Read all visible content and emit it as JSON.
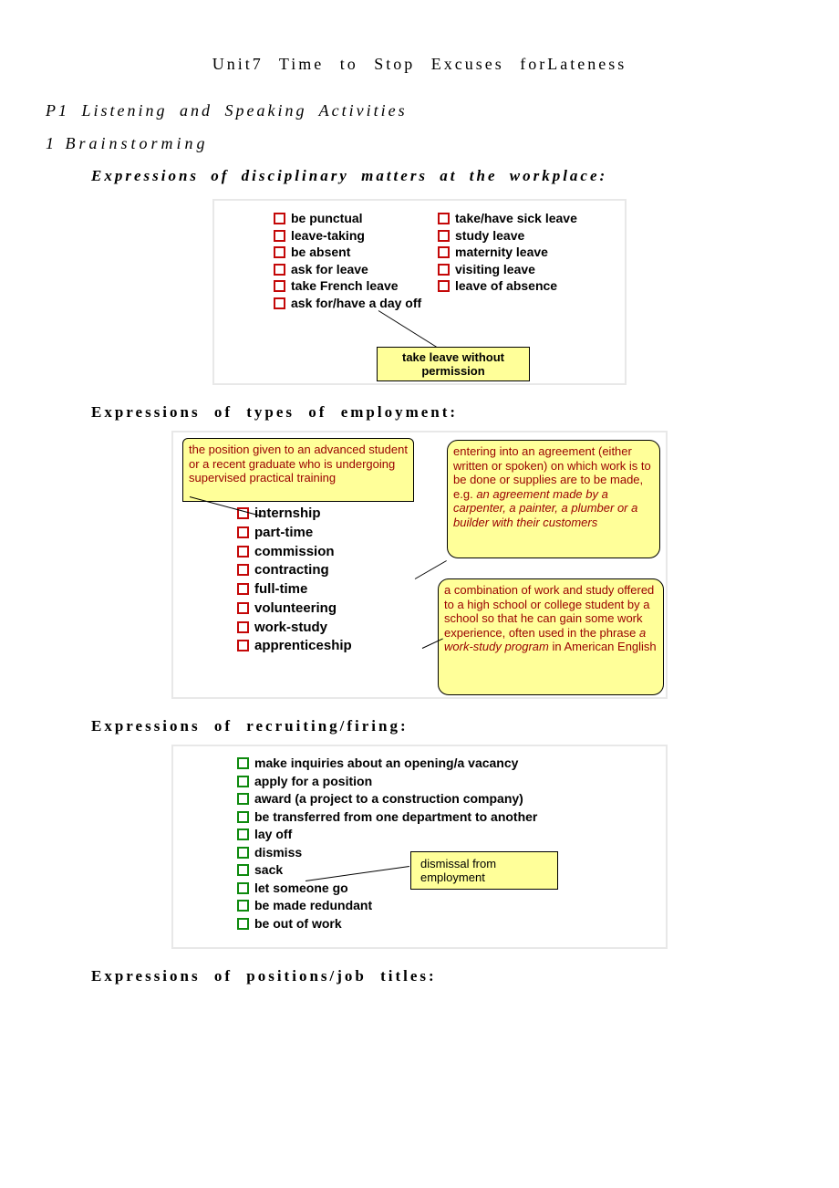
{
  "title": "Unit7  Time  to Stop  Excuses forLateness",
  "p1": "P1 Listening and Speaking Activities",
  "brainstorm": "1 Brainstorming",
  "sub1_label": "Expressions of disciplinary matters at the workplace:",
  "fig1": {
    "left": [
      "be punctual",
      "leave-taking",
      "be absent",
      "ask for leave",
      "take French leave",
      "ask for/have a day off"
    ],
    "right": [
      "take/have sick leave",
      "study leave",
      "maternity leave",
      "visiting leave",
      "leave of absence"
    ],
    "callout": "take leave without permission"
  },
  "sub2_label": "Expressions of types of employment:",
  "fig2": {
    "note1": "the position given to an advanced student or a recent graduate who is undergoing supervised practical training",
    "note2_a": "entering into an agreement (either written or spoken) on which work is to be done or supplies are to be made, e.g.",
    "note2_b": "an agreement made by a carpenter, a painter, a plumber or a builder with their customers",
    "note3_a": "a combination of work and study offered to a high school or college student by a school so that he can gain some work experience, often used in the phrase ",
    "note3_b": "a work-study program",
    "note3_c": " in American English",
    "items": [
      "internship",
      "part-time",
      "commission",
      "contracting",
      "full-time",
      "volunteering",
      "work-study",
      "apprenticeship"
    ]
  },
  "sub3_label": "Expressions of recruiting/firing:",
  "fig3": {
    "items": [
      "make inquiries about an opening/a vacancy",
      "apply for a position",
      "award (a project to a construction company)",
      "be transferred from one department to another",
      "lay off",
      "dismiss",
      "sack",
      "let someone go",
      "be made redundant",
      "be out of work"
    ],
    "callout": "dismissal from employment"
  },
  "sub4_label": "Expressions of positions/job titles:"
}
